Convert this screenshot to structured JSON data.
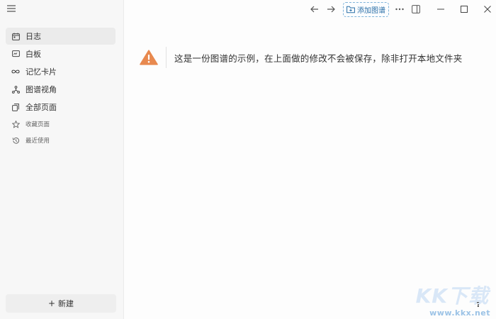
{
  "sidebar": {
    "items": [
      {
        "label": "日志",
        "icon": "calendar-icon",
        "active": true
      },
      {
        "label": "白板",
        "icon": "whiteboard-icon"
      },
      {
        "label": "记忆卡片",
        "icon": "infinity-icon"
      },
      {
        "label": "图谱视角",
        "icon": "graph-icon"
      },
      {
        "label": "全部页面",
        "icon": "pages-icon"
      }
    ],
    "secondary": [
      {
        "label": "收藏页面",
        "icon": "star-icon"
      },
      {
        "label": "最近使用",
        "icon": "history-icon"
      }
    ],
    "new_button": {
      "plus": "+",
      "label": "新建"
    }
  },
  "toolbar": {
    "add_graph_label": "添加图谱"
  },
  "notice": {
    "text": "这是一份图谱的示例，在上面做的修改不会被保存，除非打开本地文件夹"
  },
  "help_label": "?",
  "watermark": {
    "brand": "KK下载",
    "url": "www.kkx.net"
  },
  "colors": {
    "warning": "#e8894f",
    "accent": "#2a6ea6"
  }
}
